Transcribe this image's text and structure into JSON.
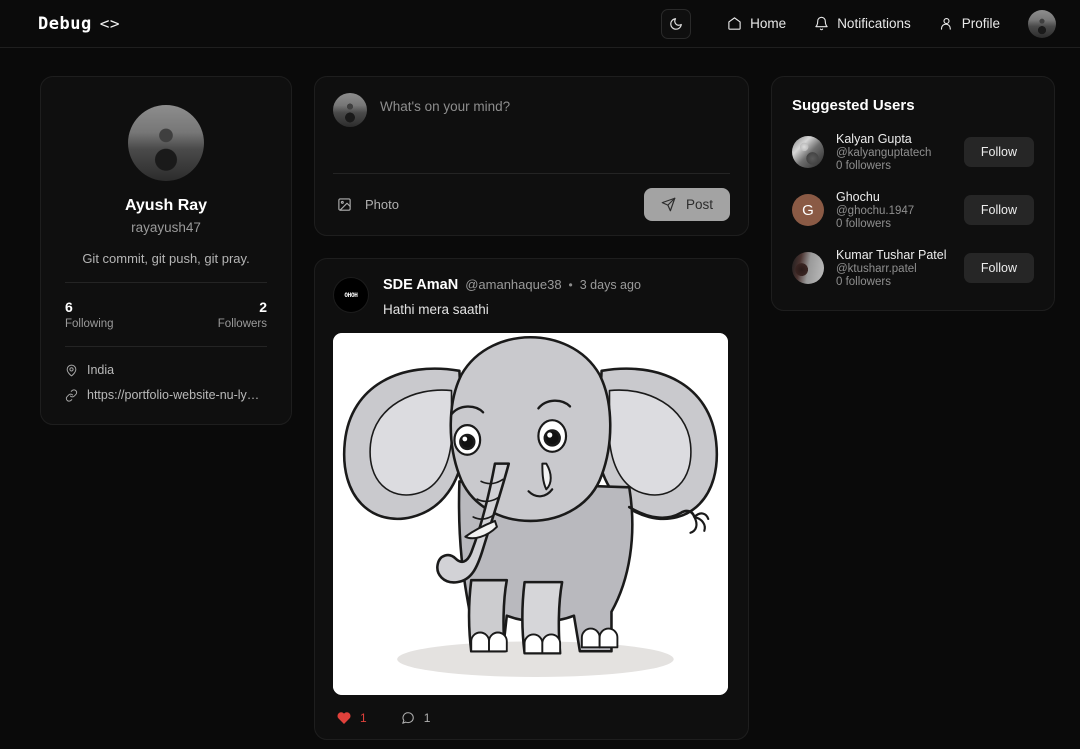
{
  "header": {
    "logo_text": "Debug",
    "logo_chevrons": "<>",
    "theme_toggle_icon": "moon-icon",
    "nav": [
      {
        "label": "Home",
        "icon": "home-icon"
      },
      {
        "label": "Notifications",
        "icon": "bell-icon"
      },
      {
        "label": "Profile",
        "icon": "user-icon"
      }
    ],
    "avatar_icon": "user-avatar"
  },
  "profile": {
    "name": "Ayush Ray",
    "handle": "rayayush47",
    "bio": "Git commit, git push, git pray.",
    "stats": [
      {
        "value": "6",
        "label": "Following"
      },
      {
        "value": "2",
        "label": "Followers"
      }
    ],
    "location": "India",
    "location_icon": "map-pin-icon",
    "website": "https://portfolio-website-nu-lyart.ver…",
    "website_icon": "link-icon"
  },
  "composer": {
    "placeholder": "What's on your mind?",
    "value": "",
    "photo_label": "Photo",
    "photo_icon": "image-icon",
    "post_label": "Post",
    "post_icon": "send-icon"
  },
  "feed": {
    "posts": [
      {
        "author": "SDE AmaN",
        "handle": "@amanhaque38",
        "separator": "•",
        "time": "3 days ago",
        "avatar_text": "OHOH",
        "text": "Hathi mera saathi",
        "image_alt": "cartoon-elephant-illustration",
        "like_count": "1",
        "like_icon": "heart-icon",
        "comment_count": "1",
        "comment_icon": "comment-icon"
      }
    ]
  },
  "suggested": {
    "title": "Suggested Users",
    "follow_label": "Follow",
    "users": [
      {
        "name": "Kalyan Gupta",
        "handle": "@kalyanguptatech",
        "followers": "0 followers",
        "avatar_type": "photo",
        "initial": ""
      },
      {
        "name": "Ghochu",
        "handle": "@ghochu.1947",
        "followers": "0 followers",
        "avatar_type": "initial",
        "initial": "G",
        "avatar_color": "#8a5a45"
      },
      {
        "name": "Kumar Tushar Patel",
        "handle": "@ktusharr.patel",
        "followers": "0 followers",
        "avatar_type": "photo",
        "initial": ""
      }
    ]
  },
  "colors": {
    "page_bg": "#0a0a0a",
    "card_bg": "#0f0f0f",
    "border": "#1e1e1e",
    "text_primary": "#ededed",
    "text_muted": "#9a9a9a",
    "like_red": "#e0413b",
    "post_btn_bg": "#a3a3a3",
    "follow_btn_bg": "#262626"
  }
}
